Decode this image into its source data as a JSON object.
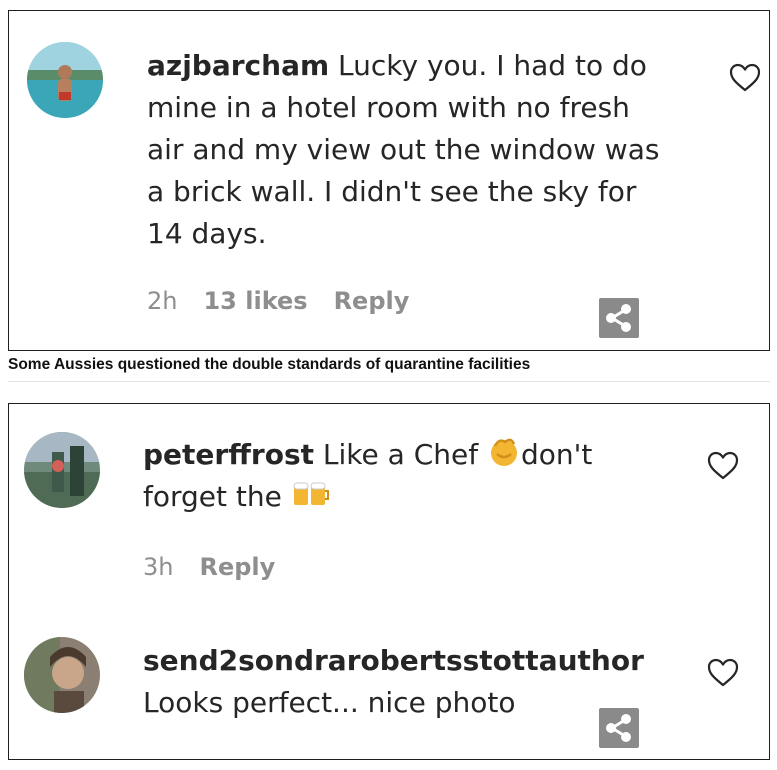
{
  "cards": [
    {
      "comments": [
        {
          "username": "azjbarcham",
          "text_lines": [
            "Lucky you. I had to do",
            "mine in a hotel room with no fresh",
            "air and my view out the window was",
            "a brick wall. I didn't see the sky for",
            "14 days."
          ],
          "time": "2h",
          "likes": "13 likes",
          "reply": "Reply"
        }
      ],
      "caption": "Some Aussies questioned the double standards of quarantine facilities"
    },
    {
      "comments": [
        {
          "username": "peterffrost",
          "text_parts": [
            "Like a Chef ",
            "don't",
            "forget the "
          ],
          "emoji_icons": [
            "clapping-hands-icon",
            "beer-mugs-icon"
          ],
          "time": "3h",
          "reply": "Reply"
        },
        {
          "username": "send2sondrarobertsstottauthor",
          "text": "Looks perfect... nice photo"
        }
      ]
    }
  ],
  "icons": {
    "heart": "heart-outline-icon",
    "share": "share-icon"
  },
  "colors": {
    "text": "#262626",
    "meta": "#8e8e8e",
    "share_bg": "#8a8a8a",
    "border": "#1f1f1f"
  }
}
